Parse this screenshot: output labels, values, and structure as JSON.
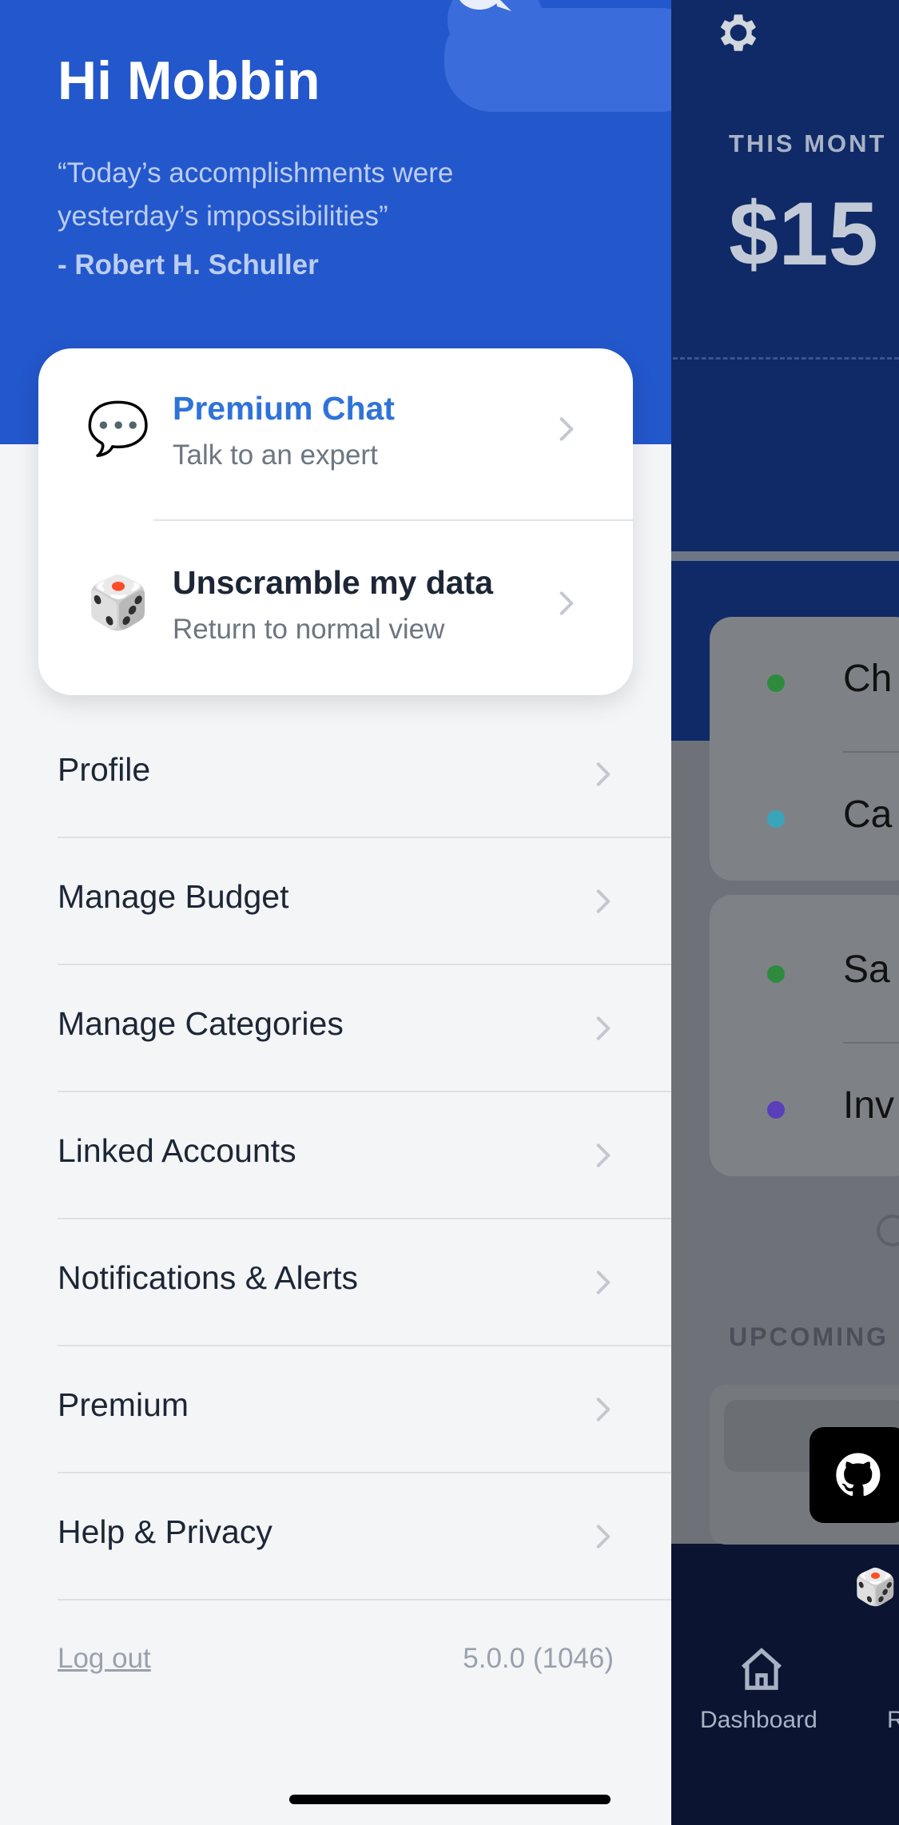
{
  "drawer": {
    "greeting": "Hi Mobbin",
    "quote": "“Today’s accomplishments were yesterday’s impossibilities”",
    "author": "- Robert H. Schuller",
    "quick_actions": [
      {
        "icon": "speech-bubble-icon",
        "emoji": "💬",
        "title": "Premium Chat",
        "subtitle": "Talk to an expert"
      },
      {
        "icon": "dice-icon",
        "emoji": "🎲",
        "title": "Unscramble my data",
        "subtitle": "Return to normal view"
      }
    ],
    "menu": [
      {
        "label": "Profile"
      },
      {
        "label": "Manage Budget"
      },
      {
        "label": "Manage Categories"
      },
      {
        "label": "Linked Accounts"
      },
      {
        "label": "Notifications & Alerts"
      },
      {
        "label": "Premium"
      },
      {
        "label": "Help & Privacy"
      }
    ],
    "logout_label": "Log out",
    "version": "5.0.0 (1046)"
  },
  "background": {
    "month_label": "THIS MONT",
    "amount": "$15",
    "accounts": [
      {
        "label": "Ch",
        "color": "#2e8b3e"
      },
      {
        "label": "Ca",
        "color": "#3aa5b8"
      },
      {
        "label": "Sa",
        "color": "#2e8b3e"
      },
      {
        "label": "Inv",
        "color": "#5a3fb8"
      }
    ],
    "upcoming_label": "UPCOMING",
    "tab_dashboard": "Dashboard",
    "tab_next": "R"
  },
  "colors": {
    "header_blue": "#2357cc",
    "accent_blue": "#2f73d9",
    "drawer_bg": "#f4f5f7",
    "text_dark": "#1d2636"
  }
}
